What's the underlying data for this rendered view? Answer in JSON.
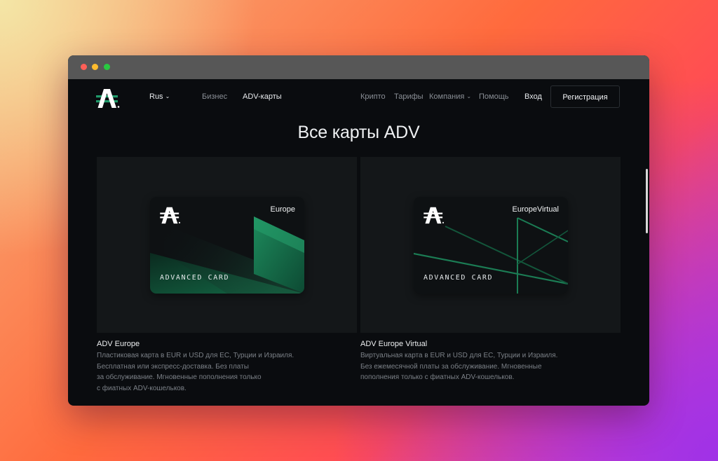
{
  "nav": {
    "lang": "Rus",
    "items_left": [
      "Бизнес",
      "ADV-карты"
    ],
    "items_right": [
      "Крипто",
      "Тарифы",
      "Компания",
      "Помощь"
    ],
    "login": "Вход",
    "register": "Регистрация"
  },
  "page": {
    "title": "Все карты ADV"
  },
  "cards": [
    {
      "region": "Europe",
      "card_name": "ADVANCED CARD",
      "title": "ADV Europe",
      "desc": [
        "Пластиковая карта в EUR и USD для ЕС, Турции и Израиля.",
        "Бесплатная или экспресс-доставка. Без платы",
        "за обслуживание. Мгновенные пополнения только",
        "с фиатных ADV-кошельков."
      ]
    },
    {
      "region": "EuropeVirtual",
      "card_name": "ADVANCED CARD",
      "title": "ADV Europe Virtual",
      "desc": [
        "Виртуальная карта в EUR и USD для ЕС, Турции и Израиля.",
        "Без ежемесячной платы за обслуживание. Мгновенные",
        "пополнения только с фиатных ADV-кошельков."
      ]
    }
  ],
  "colors": {
    "accent": "#1f9a6a",
    "background": "#0a0c0f",
    "panel": "#141719"
  }
}
